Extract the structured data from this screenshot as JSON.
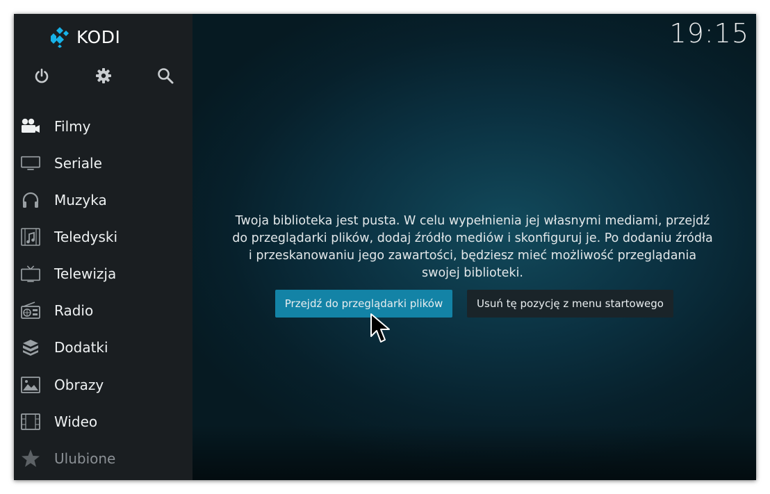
{
  "app": {
    "logo_text": "KODI",
    "clock": "19:15"
  },
  "header_icons": [
    {
      "name": "power-icon"
    },
    {
      "name": "gear-icon"
    },
    {
      "name": "search-icon"
    }
  ],
  "sidebar": {
    "items": [
      {
        "label": "Filmy",
        "icon": "movies-icon"
      },
      {
        "label": "Seriale",
        "icon": "tv-shows-icon"
      },
      {
        "label": "Muzyka",
        "icon": "headphones-icon"
      },
      {
        "label": "Teledyski",
        "icon": "music-video-icon"
      },
      {
        "label": "Telewizja",
        "icon": "live-tv-icon"
      },
      {
        "label": "Radio",
        "icon": "radio-icon"
      },
      {
        "label": "Dodatki",
        "icon": "addons-icon"
      },
      {
        "label": "Obrazy",
        "icon": "pictures-icon"
      },
      {
        "label": "Wideo",
        "icon": "video-icon"
      },
      {
        "label": "Ulubione",
        "icon": "star-icon"
      }
    ]
  },
  "main": {
    "message": "Twoja biblioteka jest pusta. W celu wypełnienia jej własnymi mediami, przejdź do przeglądarki plików, dodaj źródło mediów i skonfiguruj je. Po dodaniu źródła i przeskanowaniu jego zawartości, będziesz mieć możliwość przeglądania swojej biblioteki.",
    "primary_button": "Przejdź do przeglądarki plików",
    "secondary_button": "Usuń tę pozycję z menu startowego"
  },
  "colors": {
    "accent": "#1383a6",
    "sidebar_bg": "#1a1e21",
    "main_bg": "#0b3141",
    "kodi_blue": "#17b2e8"
  }
}
